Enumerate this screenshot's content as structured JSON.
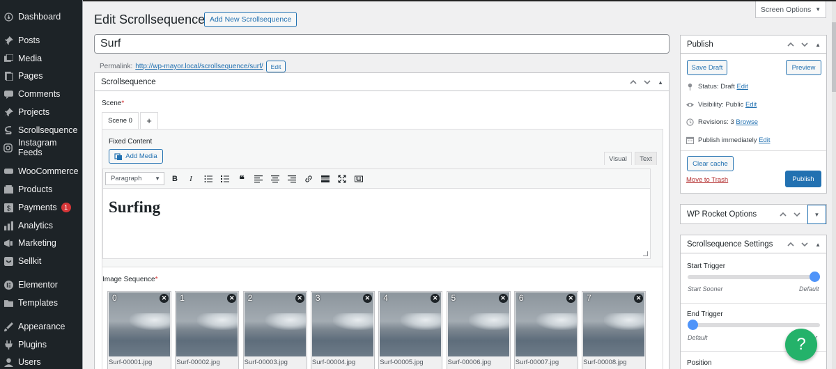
{
  "sidebar": {
    "items": [
      {
        "label": "Dashboard",
        "icon": "dashboard-icon"
      },
      {
        "label": "Posts",
        "icon": "pin-icon"
      },
      {
        "label": "Media",
        "icon": "media-icon"
      },
      {
        "label": "Pages",
        "icon": "pages-icon"
      },
      {
        "label": "Comments",
        "icon": "comment-icon"
      },
      {
        "label": "Projects",
        "icon": "pin-icon"
      },
      {
        "label": "Scrollsequence",
        "icon": "scrollsequence-icon"
      },
      {
        "label": "Instagram Feeds",
        "icon": "instagram-icon"
      },
      {
        "label": "WooCommerce",
        "icon": "woocommerce-icon"
      },
      {
        "label": "Products",
        "icon": "products-icon"
      },
      {
        "label": "Payments",
        "icon": "payments-icon",
        "badge": "1"
      },
      {
        "label": "Analytics",
        "icon": "analytics-icon"
      },
      {
        "label": "Marketing",
        "icon": "marketing-icon"
      },
      {
        "label": "Sellkit",
        "icon": "sellkit-icon"
      },
      {
        "label": "Elementor",
        "icon": "elementor-icon"
      },
      {
        "label": "Templates",
        "icon": "folder-icon"
      },
      {
        "label": "Appearance",
        "icon": "appearance-icon"
      },
      {
        "label": "Plugins",
        "icon": "plugins-icon"
      },
      {
        "label": "Users",
        "icon": "users-icon"
      }
    ]
  },
  "screen_options": "Screen Options",
  "header": {
    "title": "Edit Scrollsequence",
    "add_new": "Add New Scrollsequence"
  },
  "post_title": "Surf",
  "permalink": {
    "label": "Permalink:",
    "url": "http://wp-mayor.local/scrollsequence/surf/",
    "edit": "Edit"
  },
  "main_box": {
    "title": "Scrollsequence",
    "scene_label": "Scene",
    "required_mark": "*",
    "tab_scene": "Scene 0",
    "tab_add": "+",
    "fixed_content": "Fixed Content",
    "add_media": "Add Media",
    "tab_visual": "Visual",
    "tab_text": "Text",
    "format_select": "Paragraph",
    "editor_content": "Surfing",
    "image_sequence": "Image Sequence",
    "images": [
      {
        "num": "0",
        "file": "Surf-00001.jpg"
      },
      {
        "num": "1",
        "file": "Surf-00002.jpg"
      },
      {
        "num": "2",
        "file": "Surf-00003.jpg"
      },
      {
        "num": "3",
        "file": "Surf-00004.jpg"
      },
      {
        "num": "4",
        "file": "Surf-00005.jpg"
      },
      {
        "num": "5",
        "file": "Surf-00006.jpg"
      },
      {
        "num": "6",
        "file": "Surf-00007.jpg"
      },
      {
        "num": "7",
        "file": "Surf-00008.jpg"
      }
    ]
  },
  "publish": {
    "title": "Publish",
    "save_draft": "Save Draft",
    "preview": "Preview",
    "status_label": "Status:",
    "status_value": "Draft",
    "visibility_label": "Visibility:",
    "visibility_value": "Public",
    "revisions_label": "Revisions:",
    "revisions_value": "3",
    "browse": "Browse",
    "publish_label": "Publish",
    "publish_value": "immediately",
    "edit": "Edit",
    "clear_cache": "Clear cache",
    "move_to_trash": "Move to Trash",
    "publish_button": "Publish"
  },
  "wp_rocket": {
    "title": "WP Rocket Options"
  },
  "ss_settings": {
    "title": "Scrollsequence Settings",
    "start_trigger": "Start Trigger",
    "start_sooner": "Start Sooner",
    "default": "Default",
    "start_value": 1.0,
    "end_trigger": "End Trigger",
    "end_value": 0.0,
    "end_right_partial": "er",
    "position": "Position"
  },
  "help": "?"
}
